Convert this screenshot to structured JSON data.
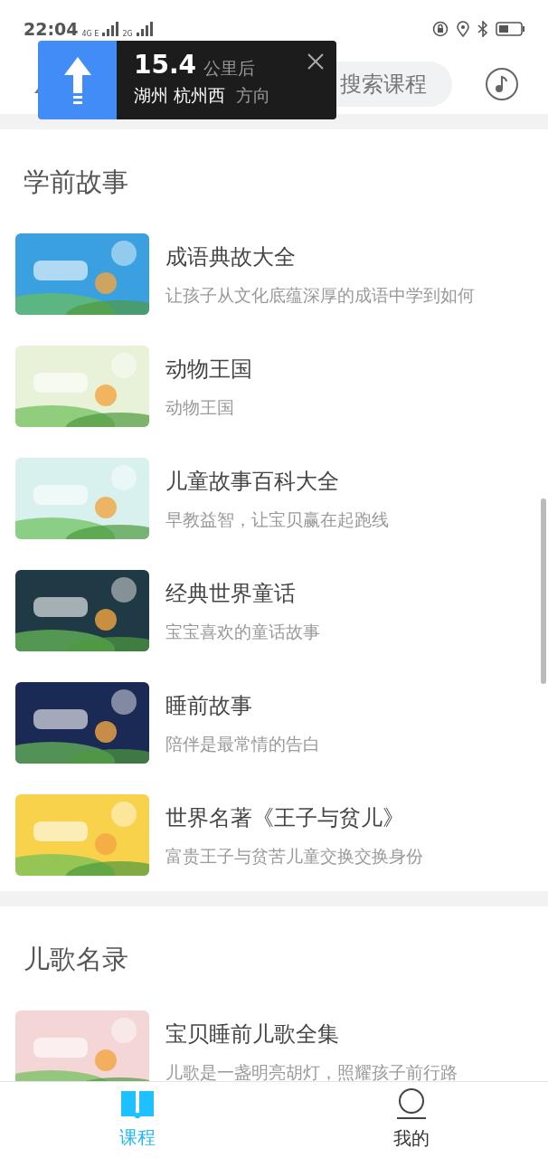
{
  "status_bar": {
    "time": "22:04",
    "network_1": "4G E",
    "network_2": "2G"
  },
  "header": {
    "search": {
      "placeholder": "搜索课程"
    }
  },
  "navigation_popup": {
    "distance": "15.4",
    "distance_unit": "公里后",
    "road": "湖州 杭州西",
    "direction": "方向"
  },
  "sections": [
    {
      "title": "学前故事",
      "items": [
        {
          "title": "成语典故大全",
          "subtitle": "让孩子从文化底蕴深厚的成语中学到如何",
          "color": "#3aa0e0"
        },
        {
          "title": "动物王国",
          "subtitle": "动物王国",
          "color": "#e8f2d8"
        },
        {
          "title": "儿童故事百科大全",
          "subtitle": "早教益智，让宝贝赢在起跑线",
          "color": "#d8f1ee"
        },
        {
          "title": "经典世界童话",
          "subtitle": "宝宝喜欢的童话故事",
          "color": "#1f3a44"
        },
        {
          "title": "睡前故事",
          "subtitle": "陪伴是最常情的告白",
          "color": "#1b2a55"
        },
        {
          "title": "世界名著《王子与贫儿》",
          "subtitle": "富贵王子与贫苦儿童交换交换身份",
          "color": "#f7d24a"
        }
      ]
    },
    {
      "title": "儿歌名录",
      "items": [
        {
          "title": "宝贝睡前儿歌全集",
          "subtitle": "儿歌是一盏明亮胡灯，照耀孩子前行路",
          "color": "#f5d6d6"
        }
      ]
    }
  ],
  "tabs": [
    {
      "label": "课程",
      "kind": "book",
      "selected": true
    },
    {
      "label": "我的",
      "kind": "person",
      "selected": false
    }
  ]
}
